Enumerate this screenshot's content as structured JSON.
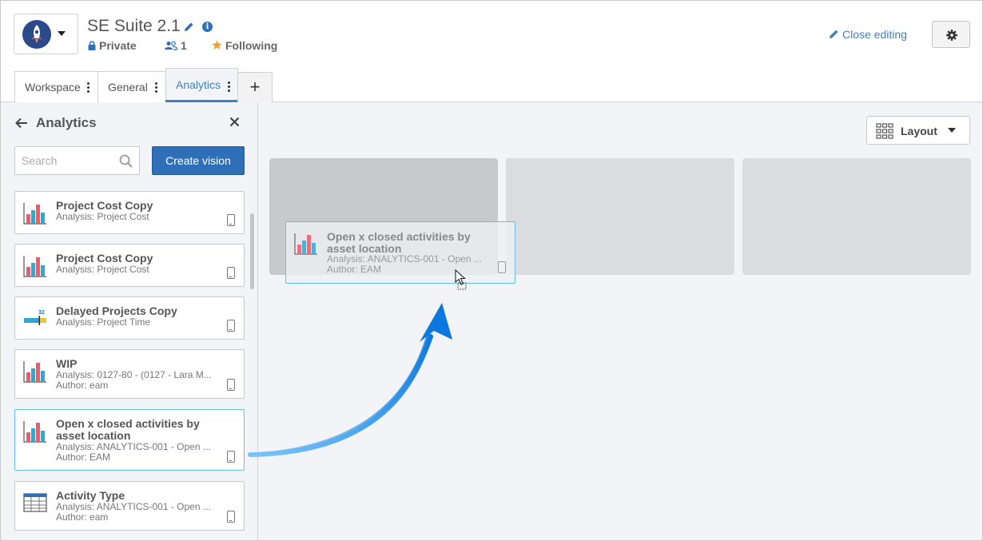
{
  "header": {
    "title": "SE Suite 2.1",
    "privacy": "Private",
    "members_count": "1",
    "following": "Following",
    "close_editing": "Close editing"
  },
  "tabs": [
    {
      "label": "Workspace",
      "active": false
    },
    {
      "label": "General",
      "active": false
    },
    {
      "label": "Analytics",
      "active": true
    }
  ],
  "sidebar": {
    "title": "Analytics",
    "search_placeholder": "Search",
    "create_button": "Create vision",
    "items": [
      {
        "title": "Project Cost Copy",
        "analysis": "Analysis: Project Cost",
        "author": "",
        "icon": "bar-chart-icon"
      },
      {
        "title": "Project Cost Copy",
        "analysis": "Analysis: Project Cost",
        "author": "",
        "icon": "bar-chart-icon"
      },
      {
        "title": "Delayed Projects Copy",
        "analysis": "Analysis: Project Time",
        "author": "",
        "icon": "gauge-bar-icon",
        "badge": "32"
      },
      {
        "title": "WIP",
        "analysis": "Analysis: 0127-80 - (0127 - Lara M...",
        "author": "Author: eam",
        "icon": "bar-chart-icon"
      },
      {
        "title": "Open x closed activities by asset location",
        "analysis": "Analysis: ANALYTICS-001 - Open ...",
        "author": "Author: EAM",
        "icon": "bar-chart-icon",
        "highlighted": true
      },
      {
        "title": "Activity Type",
        "analysis": "Analysis: ANALYTICS-001 - Open ...",
        "author": "Author: eam",
        "icon": "table-icon"
      }
    ]
  },
  "main": {
    "layout_button": "Layout",
    "drag_item": {
      "title": "Open x closed activities by asset location",
      "analysis": "Analysis: ANALYTICS-001 - Open ...",
      "author": "Author: EAM"
    }
  },
  "colors": {
    "accent": "#2f6fb7",
    "link": "#3f7fc4",
    "highlight_border": "#63c1e8",
    "arrow": "#1a86e8",
    "star": "#f0a030"
  }
}
